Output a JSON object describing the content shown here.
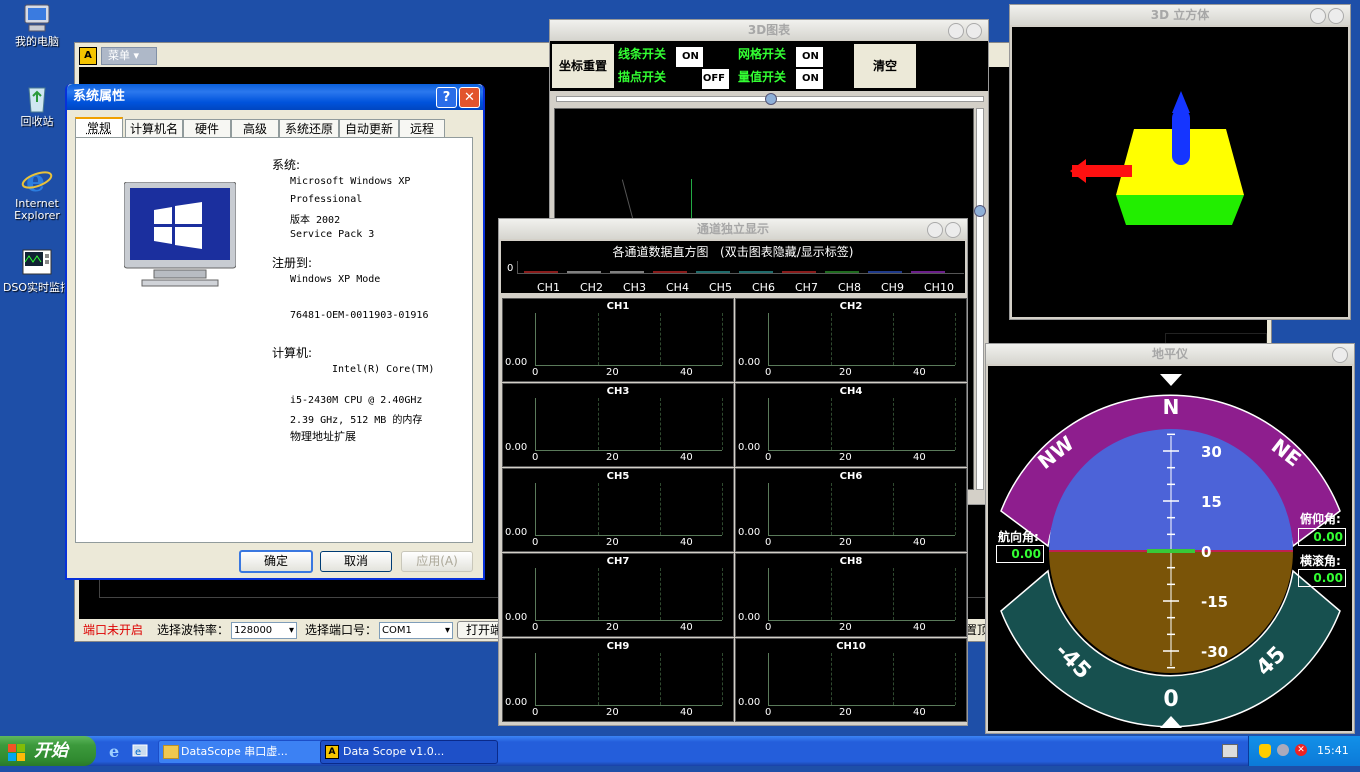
{
  "desktop": {
    "icons": [
      {
        "label": "我的电脑",
        "icon": "my-computer-icon"
      },
      {
        "label": "回收站",
        "icon": "recycle-bin-icon"
      },
      {
        "label": "Internet Explorer",
        "icon": "internet-explorer-icon"
      },
      {
        "label": "DSO实时监拮",
        "icon": "dso-monitor-icon"
      }
    ]
  },
  "main_app": {
    "menu_label": "菜单",
    "status": {
      "port_state": "端口未开启",
      "baud_label": "选择波特率：",
      "baud_value": "128000",
      "port_label": "选择端口号：",
      "port_value": "COM1",
      "open_button": "打开端",
      "right_text": "置顶"
    }
  },
  "sys_props": {
    "title": "系统属性",
    "tabs": [
      "常规",
      "计算机名",
      "硬件",
      "高级",
      "系统还原",
      "自动更新",
      "远程"
    ],
    "system_label": "系统:",
    "os_lines": [
      "Microsoft Windows XP",
      "Professional",
      "版本 2002",
      "Service Pack 3"
    ],
    "registered_label": "注册到:",
    "registered_to": "Windows XP Mode",
    "product_id": "76481-OEM-0011903-01916",
    "computer_label": "计算机:",
    "cpu_line1": "Intel(R) Core(TM)",
    "cpu_line2": "i5-2430M CPU @ 2.40GHz",
    "cpu_line3": "2.39 GHz, 512 MB 的内存",
    "cpu_line4": "物理地址扩展",
    "buttons": {
      "ok": "确定",
      "cancel": "取消",
      "apply": "应用(A)"
    }
  },
  "chart3d": {
    "title": "3D图表",
    "reset": "坐标重置",
    "line_switch": "线条开关",
    "line_value": "ON",
    "point_switch": "描点开关",
    "point_value": "OFF",
    "grid_switch": "网格开关",
    "grid_value": "ON",
    "scale_switch": "量值开关",
    "scale_value": "ON",
    "clear": "清空"
  },
  "cube": {
    "title": "3D 立方体"
  },
  "channels": {
    "title": "通道独立显示",
    "hist_title": "各通道数据直方图",
    "hist_hint": "(双击图表隐藏/显示标签)",
    "hist_zero": "0",
    "hist_colors": [
      "#8a1c1c",
      "#808080",
      "#808080",
      "#8a1c1c",
      "#1f6b6b",
      "#1f6b6b",
      "#8a1c1c",
      "#1f6b1f",
      "#1f3a8a",
      "#6b1f8a"
    ],
    "labels": [
      "CH1",
      "CH2",
      "CH3",
      "CH4",
      "CH5",
      "CH6",
      "CH7",
      "CH8",
      "CH9",
      "CH10"
    ],
    "y_label": "0.00",
    "x_ticks": [
      "0",
      "20",
      "40"
    ]
  },
  "attitude": {
    "title": "地平仪",
    "compass": [
      "N",
      "NW",
      "NE"
    ],
    "pitch_labels": [
      "30",
      "15",
      "0",
      "-15",
      "-30"
    ],
    "roll_labels": [
      "-45",
      "0",
      "45"
    ],
    "heading_label": "航向角:",
    "heading_value": "0.00",
    "pitch_label": "俯仰角:",
    "pitch_value": "0.00",
    "roll_label": "横滚角:",
    "roll_value": "0.00",
    "colors": {
      "sky": "#4c63d8",
      "ground": "#7a5408",
      "ring_top": "#8e1e8e",
      "ring_bottom": "#17504f"
    }
  },
  "taskbar": {
    "start": "开始",
    "tasks": [
      "DataScope 串口虚...",
      "Data Scope  v1.0..."
    ],
    "clock": "15:41"
  }
}
